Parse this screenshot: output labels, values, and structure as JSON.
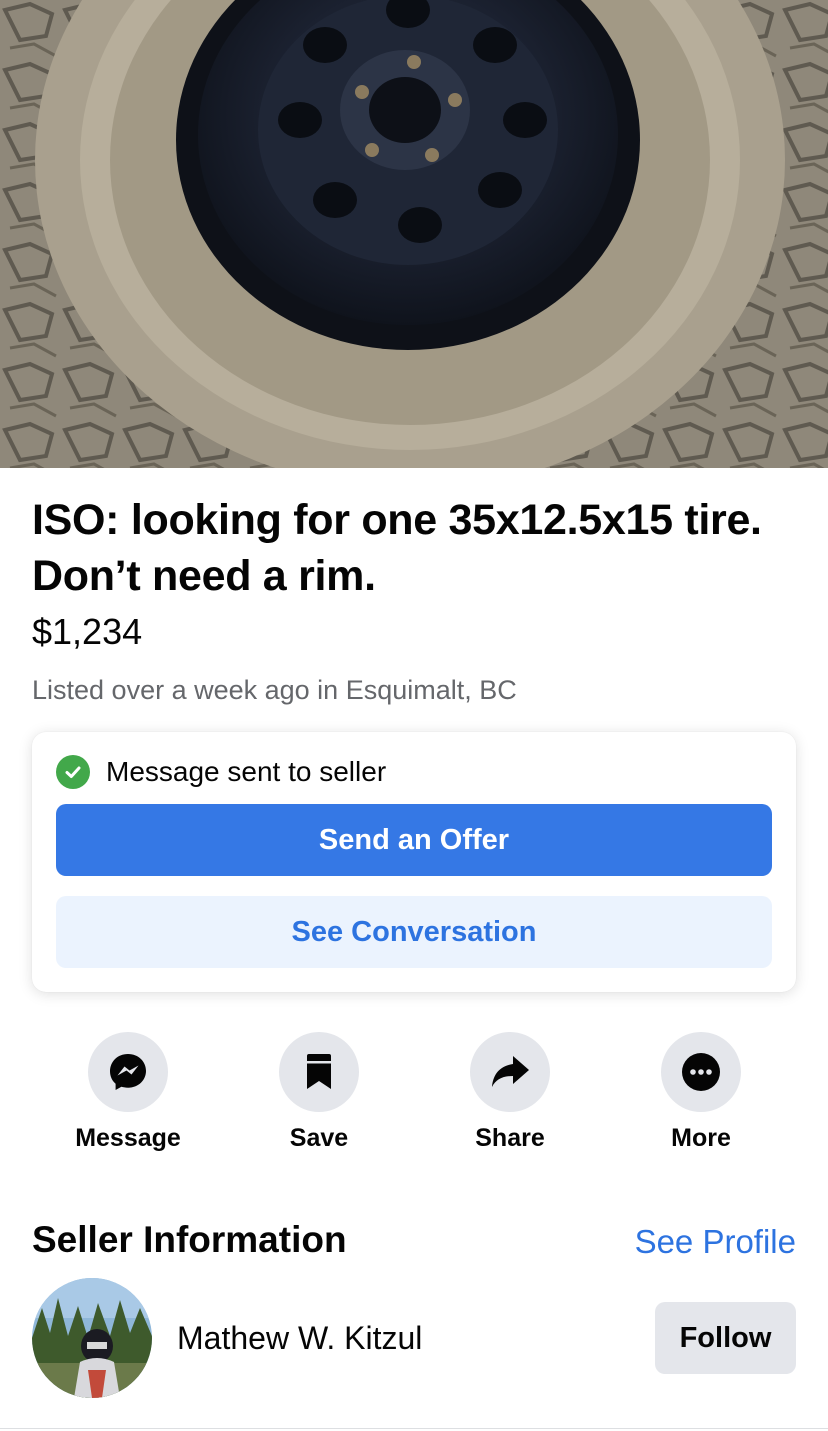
{
  "listing": {
    "photo_icon": "tire-photo",
    "title": "ISO: looking for one 35x12.5x15 tire. Don’t need a rim.",
    "price": "$1,234",
    "listed": "Listed over a week ago in Esquimalt, BC"
  },
  "message_card": {
    "status_icon": "check-circle-icon",
    "status_text": "Message sent to seller",
    "offer_button": "Send an Offer",
    "conversation_button": "See Conversation"
  },
  "actions": [
    {
      "label": "Message",
      "icon": "messenger-icon"
    },
    {
      "label": "Save",
      "icon": "bookmark-icon"
    },
    {
      "label": "Share",
      "icon": "share-icon"
    },
    {
      "label": "More",
      "icon": "more-icon"
    }
  ],
  "seller": {
    "heading": "Seller Information",
    "see_profile": "See Profile",
    "name": "Mathew W. Kitzul",
    "follow_button": "Follow"
  },
  "colors": {
    "primary_blue": "#3578e5",
    "link_blue": "#2d73e0",
    "light_blue_bg": "#ebf3fe",
    "success_green": "#42a84a",
    "gray_button": "#e4e6eb",
    "secondary_text": "#65676b"
  }
}
